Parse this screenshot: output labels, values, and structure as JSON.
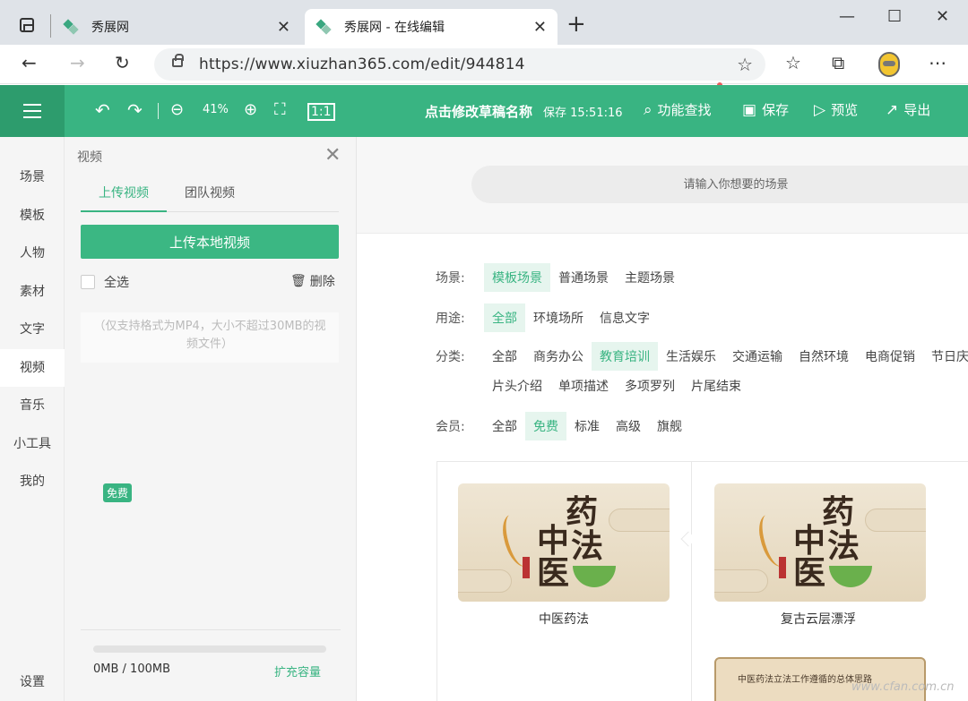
{
  "browser": {
    "tabs": [
      {
        "title": "秀展网"
      },
      {
        "title": "秀展网 - 在线编辑"
      }
    ],
    "new_tab": "+",
    "url": "https://www.xiuzhan365.com/edit/944814"
  },
  "header": {
    "zoom": "41%",
    "draft_title": "点击修改草稿名称",
    "save_status": "保存 15:51:16",
    "actions": [
      {
        "label": "功能查找",
        "icon": "search-icon"
      },
      {
        "label": "保存",
        "icon": "save-icon"
      },
      {
        "label": "预览",
        "icon": "preview-icon"
      },
      {
        "label": "导出",
        "icon": "export-icon"
      }
    ]
  },
  "sidebar": {
    "items": [
      "场景",
      "模板",
      "人物",
      "素材",
      "文字",
      "视频",
      "音乐",
      "小工具",
      "我的"
    ],
    "active": "视频",
    "settings": "设置"
  },
  "panel": {
    "title": "视频",
    "tabs": [
      "上传视频",
      "团队视频"
    ],
    "upload_button": "上传本地视频",
    "select_all": "全选",
    "delete": "删除",
    "hint": "（仅支持格式为MP4，大小不超过30MB的视频文件）",
    "storage_used_fraction": 0.0,
    "storage_text": "0MB / 100MB",
    "expand": "扩充容量"
  },
  "main": {
    "search_placeholder": "请输入你想要的场景",
    "filters": {
      "scene": {
        "label": "场景:",
        "options": [
          "模板场景",
          "普通场景",
          "主题场景"
        ],
        "active": "模板场景"
      },
      "usage": {
        "label": "用途:",
        "options": [
          "全部",
          "环境场所",
          "信息文字"
        ],
        "active": "全部"
      },
      "category": {
        "label": "分类:",
        "options": [
          "全部",
          "商务办公",
          "教育培训",
          "生活娱乐",
          "交通运输",
          "自然环境",
          "电商促销",
          "节日庆"
        ],
        "options2": [
          "片头介绍",
          "单项描述",
          "多项罗列",
          "片尾结束"
        ],
        "active": "教育培训"
      },
      "member": {
        "label": "会员:",
        "options": [
          "全部",
          "免费",
          "标准",
          "高级",
          "旗舰"
        ],
        "active": "免费"
      }
    },
    "cards": [
      {
        "title": "中医药法",
        "badge": "免费",
        "art_text_1": "药",
        "art_text_2": "法",
        "art_text_3": "中",
        "art_text_4": "医"
      },
      {
        "title": "复古云层漂浮",
        "art_text_1": "药",
        "art_text_2": "法",
        "art_text_3": "中",
        "art_text_4": "医"
      }
    ],
    "card3_text": "中医药法立法工作遵循的总体思路"
  },
  "watermark": "www.cfan.com.cn"
}
